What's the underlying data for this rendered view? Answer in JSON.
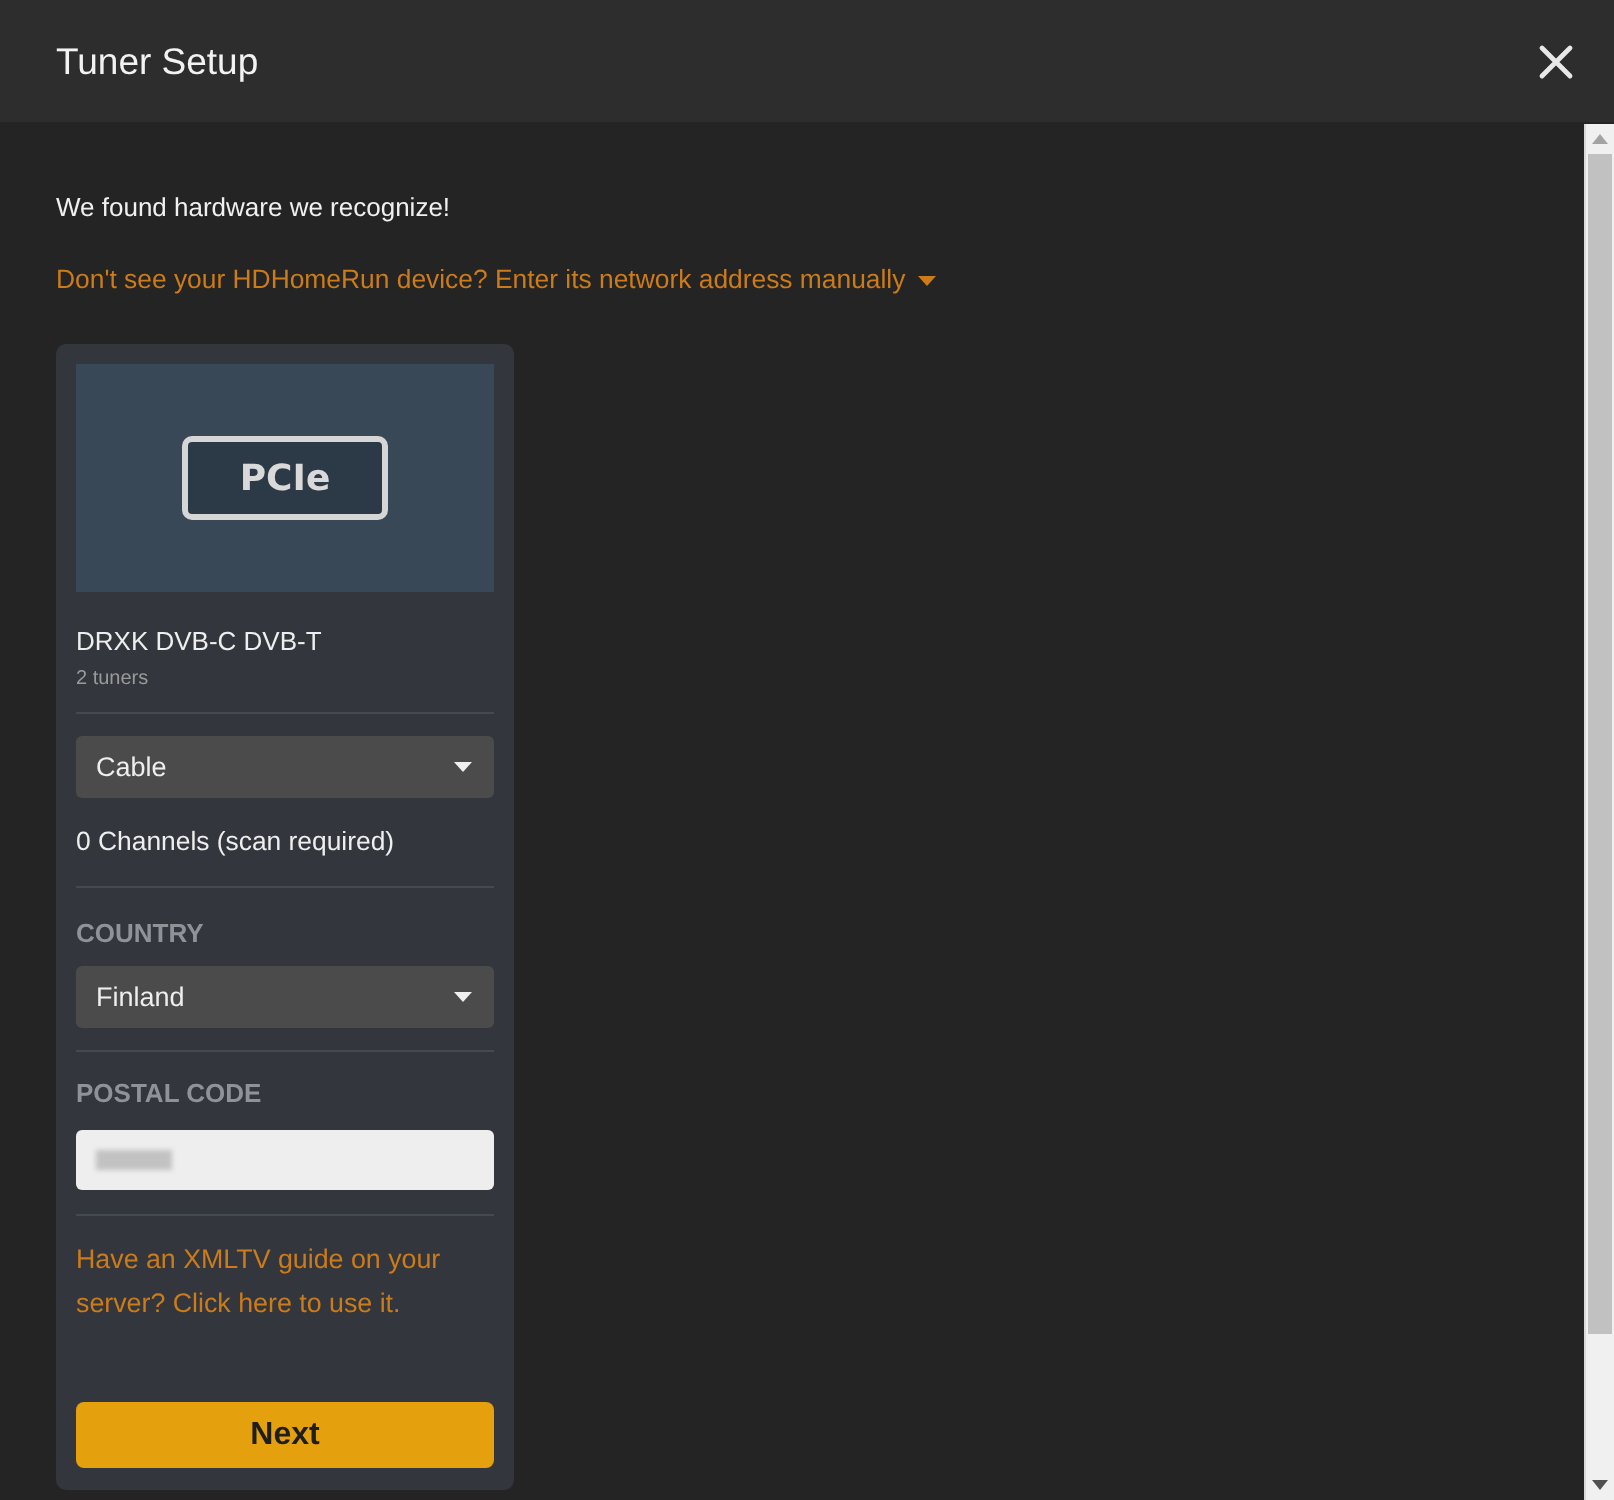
{
  "dialog": {
    "title": "Tuner Setup"
  },
  "intro": "We found hardware we recognize!",
  "manual_link": {
    "label": "Don't see your HDHomeRun device? Enter its network address manually",
    "expanded": false
  },
  "device_card": {
    "badge": "PCIe",
    "name": "DRXK DVB-C DVB-T",
    "tuner_count": "2 tuners",
    "source_select": {
      "value": "Cable"
    },
    "channel_status": "0 Channels (scan required)",
    "country": {
      "label": "COUNTRY",
      "value": "Finland"
    },
    "postal_code": {
      "label": "POSTAL CODE",
      "value_blurred": true
    },
    "xmltv_link": "Have an XMLTV guide on your server? Click here to use it.",
    "next_button": "Next"
  }
}
